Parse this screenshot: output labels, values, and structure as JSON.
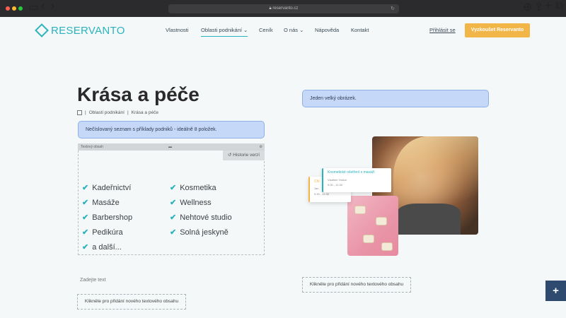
{
  "browser": {
    "url": "reservanto.cz"
  },
  "header": {
    "logo_text": "RESERVANTO",
    "nav": [
      {
        "label": "Vlastnosti"
      },
      {
        "label": "Oblasti podnikání"
      },
      {
        "label": "Ceník"
      },
      {
        "label": "O nás"
      },
      {
        "label": "Nápověda"
      },
      {
        "label": "Kontakt"
      }
    ],
    "login_label": "Přihlásit se",
    "cta_label": "Vyzkoušet Reservanto"
  },
  "page": {
    "title": "Krása a péče",
    "breadcrumb": [
      "Oblasti podnikání",
      "Krása a péče"
    ],
    "breadcrumb_sep": "|",
    "note_left": "Nečíslovaný seznam s příklady podniků - ideálně 8 položek.",
    "note_right": "Jeden velký obrázek.",
    "editor_label": "Textový obsah",
    "history_label": "Historie verzí",
    "list_col1": [
      "Kadeřnictví",
      "Masáže",
      "Barbershop",
      "Pedikúra",
      "a další..."
    ],
    "list_col2": [
      "Kosmetika",
      "Wellness",
      "Nehtové studio",
      "Solná jeskyně"
    ],
    "placeholder": "Zadejte text",
    "add_text_left": "Klikněte pro přidání nového textového obsahu",
    "add_text_right": "Klikněte pro přidání nového textového obsahu"
  },
  "cards": {
    "front_title": "Kosmetické ošetření s masáží",
    "front_name": "Vladimír Hrubá",
    "front_time": "9:30 - 11:30",
    "back_title": "Chi",
    "back_sub": "Jan",
    "back_time": "9:30 - 11:30"
  },
  "fab_label": "+",
  "colors": {
    "accent": "#2bb3bd",
    "cta": "#f2b547",
    "note_bg": "#c5d8f7",
    "fab_bg": "#2e4a6e"
  }
}
